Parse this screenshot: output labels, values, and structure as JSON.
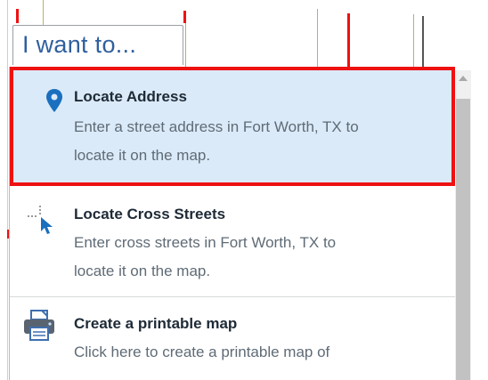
{
  "tab": {
    "label": "I want to..."
  },
  "menu": {
    "items": [
      {
        "title": "Locate Address",
        "desc_line1": "Enter a street address in Fort Worth, TX to",
        "desc_line2": "locate it on the map.",
        "icon": "map-pin-icon",
        "selected": true
      },
      {
        "title": "Locate Cross Streets",
        "desc_line1": "Enter cross streets in Fort Worth, TX to",
        "desc_line2": "locate it on the map.",
        "icon": "crosshair-cursor-icon",
        "selected": false
      },
      {
        "title": "Create a printable map",
        "desc_line1": "Click here to create a printable map of",
        "desc_line2": "",
        "icon": "printer-icon",
        "selected": false
      }
    ]
  },
  "colors": {
    "accent": "#2f5f9e",
    "selected_bg": "#dbeaf8",
    "highlight_border": "#ee1111",
    "pin": "#1a6fbf"
  }
}
